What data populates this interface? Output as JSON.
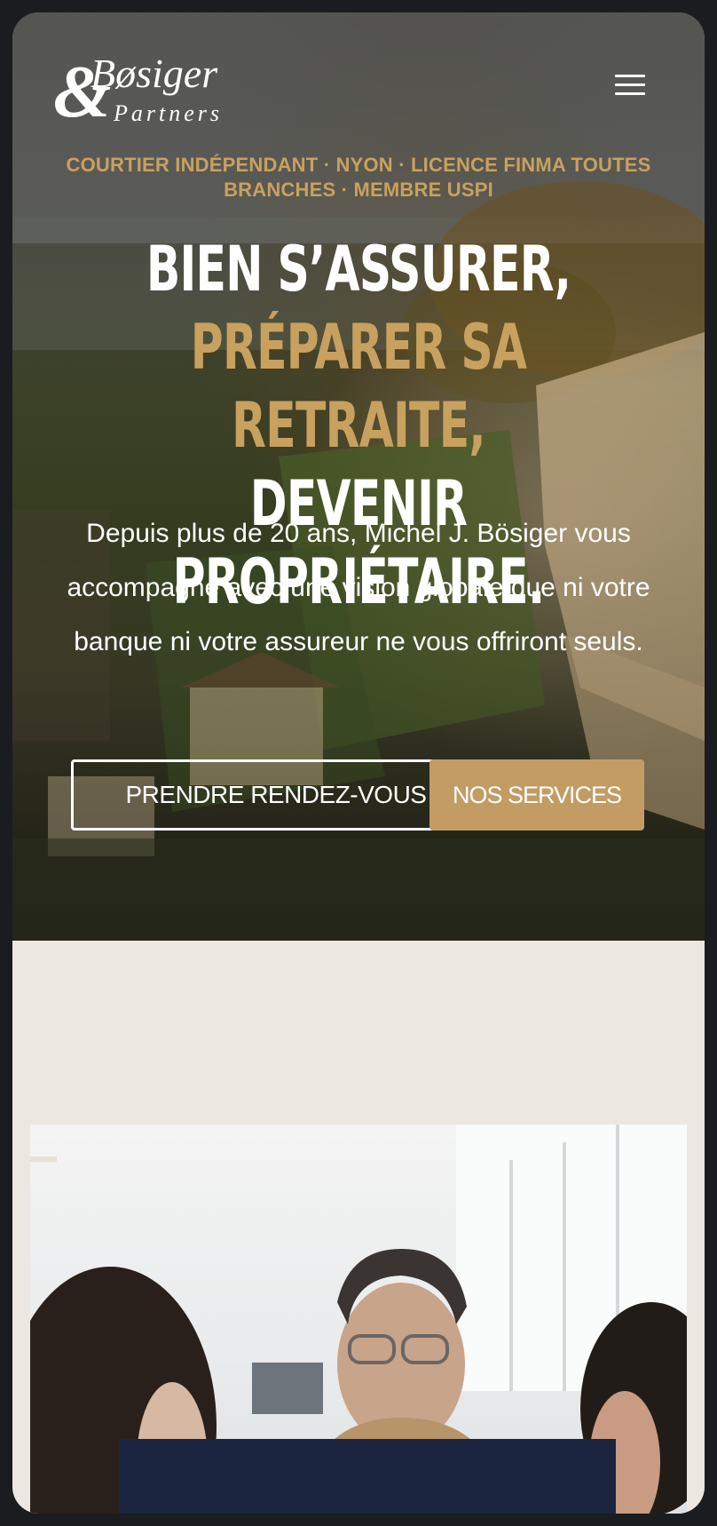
{
  "brand": {
    "logo_ampersand": "&",
    "logo_name": "Bøsiger",
    "logo_sub": "Partners",
    "gold": "#c8a15f",
    "navy": "#1c2540",
    "cream": "#ece7e0"
  },
  "header": {
    "menu_icon": "hamburger-menu-icon"
  },
  "hero": {
    "tagline": "COURTIER INDÉPENDANT · NYON · LICENCE FINMA TOUTES BRANCHES · MEMBRE USPI",
    "headline_1": "BIEN S’ASSURER,",
    "headline_2": "PRÉPARER SA RETRAITE,",
    "headline_3": "DEVENIR PROPRIÉTAIRE.",
    "intro": "Depuis plus de 20 ans, Michel J. Bösiger vous accompagne avec une vision globale que ni votre banque ni votre assureur ne vous offriront seuls.",
    "cta_primary": "PRENDRE RENDEZ-VOUS",
    "cta_secondary": "NOS SERVICES"
  }
}
